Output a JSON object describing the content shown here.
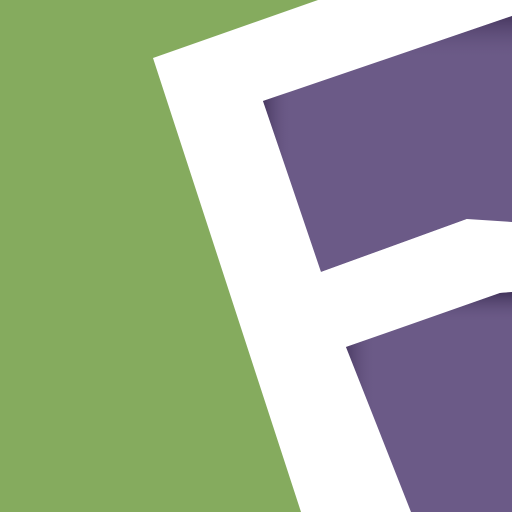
{
  "logo": {
    "icon_name": "letter-f-logo-icon",
    "letter": "F",
    "colors": {
      "background": "#85ab5e",
      "letter": "#ffffff",
      "panel": "#6b5a87",
      "panel_shadow": "#3f3057"
    }
  }
}
